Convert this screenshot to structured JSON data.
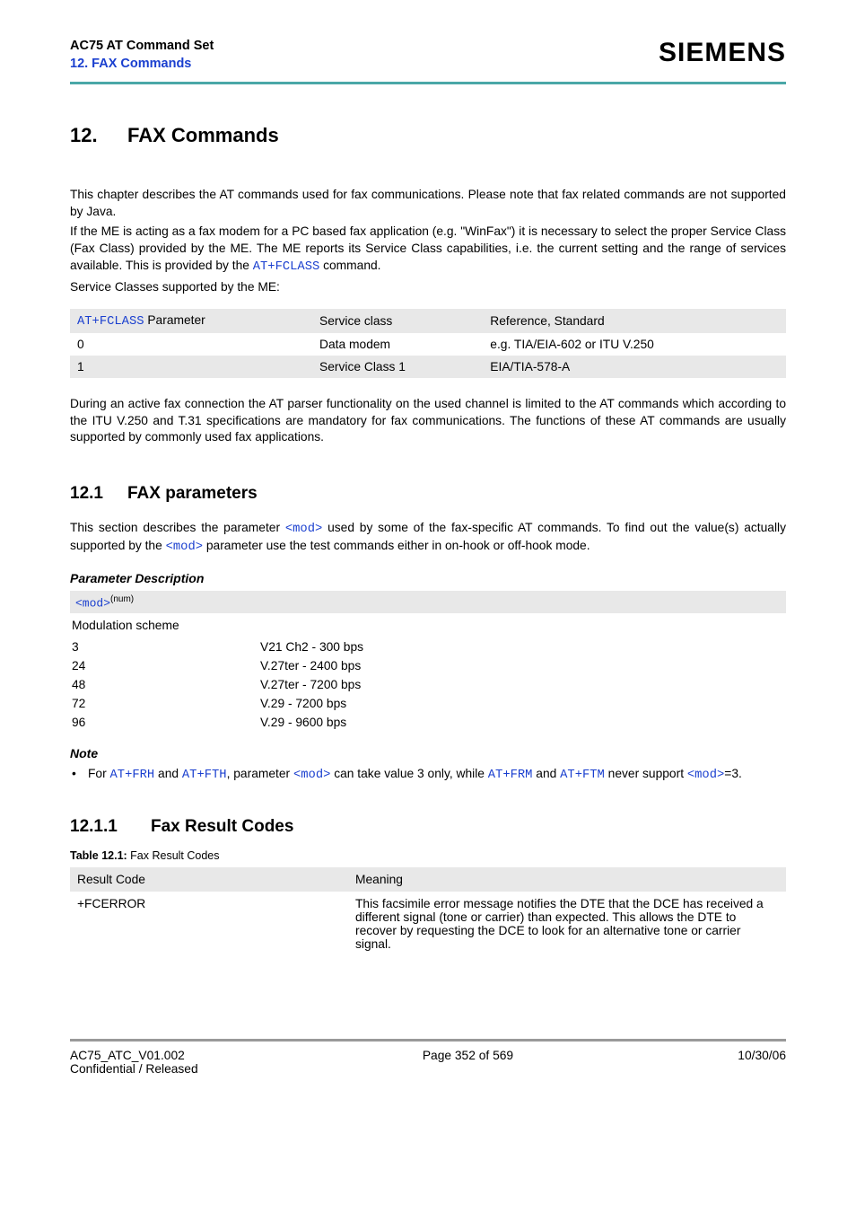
{
  "header": {
    "title": "AC75 AT Command Set",
    "subtitle": "12. FAX Commands",
    "logo": "SIEMENS"
  },
  "chapter": {
    "num": "12.",
    "title": "FAX Commands",
    "para1_a": "This chapter describes the AT commands used for fax communications. Please note that fax related commands are not supported by Java.",
    "para1_b_pre": "If the ME is acting as a fax modem for a PC based fax application (e.g. \"WinFax\") it is necessary to select the proper Service Class (Fax Class) provided by the ME. The ME reports its Service Class capabilities, i.e. the current setting and the range of services available. This is provided by the ",
    "para1_b_link": "AT+FCLASS",
    "para1_b_post": " command.",
    "para2": "Service Classes supported by the ME:",
    "para3": "During an active fax connection the AT parser functionality on the used channel is limited to the AT commands which according to the ITU V.250 and T.31 specifications are mandatory for fax communications. The functions of these AT commands are usually supported by commonly used fax applications."
  },
  "classesTable": {
    "headers": {
      "a_link": "AT+FCLASS",
      "a_rest": " Parameter",
      "b": "Service class",
      "c": "Reference, Standard"
    },
    "rows": [
      {
        "a": "0",
        "b": "Data modem",
        "c": "e.g. TIA/EIA-602 or ITU V.250"
      },
      {
        "a": "1",
        "b": "Service Class 1",
        "c": "EIA/TIA-578-A"
      }
    ]
  },
  "section": {
    "num": "12.1",
    "title": "FAX parameters",
    "para_pre": "This section describes the parameter ",
    "para_mod1": "<mod>",
    "para_mid": " used by some of the fax-specific AT commands. To find out the value(s) actually supported by the ",
    "para_mod2": "<mod>",
    "para_post": " parameter use the test commands either in on-hook or off-hook mode.",
    "paramDescHead": "Parameter Description",
    "modBar": {
      "tag": "<mod>",
      "sup": "(num)"
    },
    "modTitle": "Modulation scheme",
    "mods": [
      {
        "v": "3",
        "d": "V21 Ch2 - 300 bps"
      },
      {
        "v": "24",
        "d": "V.27ter - 2400 bps"
      },
      {
        "v": "48",
        "d": "V.27ter - 7200 bps"
      },
      {
        "v": "72",
        "d": "V.29 - 7200 bps"
      },
      {
        "v": "96",
        "d": "V.29 - 9600 bps"
      }
    ],
    "noteHead": "Note",
    "note": {
      "pre": "For ",
      "l1": "AT+FRH",
      "mid1": " and ",
      "l2": "AT+FTH",
      "mid2": ", parameter ",
      "mod1": "<mod>",
      "mid3": " can take value 3 only, while ",
      "l3": "AT+FRM",
      "mid4": " and ",
      "l4": "AT+FTM",
      "mid5": " never support ",
      "mod2": "<mod>",
      "post": "=3."
    }
  },
  "subsection": {
    "num": "12.1.1",
    "title": "Fax Result Codes",
    "caption_lbl": "Table 12.1:",
    "caption_txt": "  Fax Result Codes",
    "headers": {
      "a": "Result Code",
      "b": "Meaning"
    },
    "rows": [
      {
        "code": "+FCERROR",
        "meaning": "This facsimile error message notifies the DTE that the DCE has received a different signal (tone or carrier) than expected. This allows the DTE to recover by requesting the DCE to look for an alternative tone or carrier signal."
      }
    ]
  },
  "footer": {
    "left1": "AC75_ATC_V01.002",
    "left2": "Confidential / Released",
    "center": "Page 352 of 569",
    "right": "10/30/06"
  }
}
